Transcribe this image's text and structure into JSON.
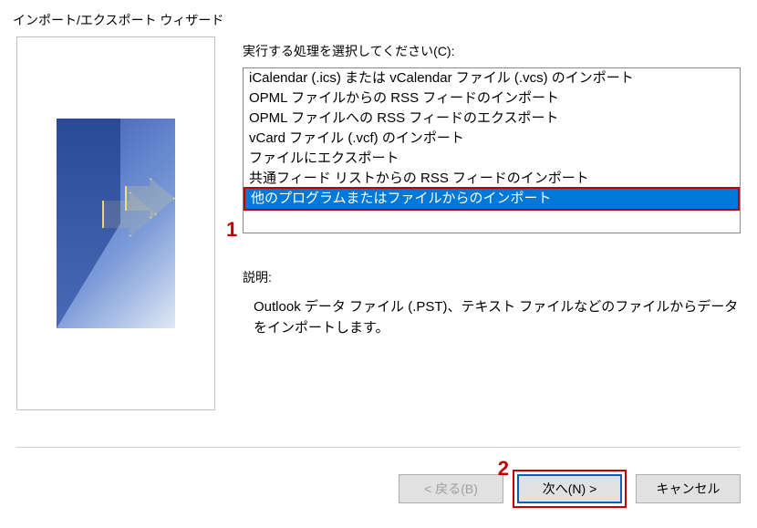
{
  "title": "インポート/エクスポート ウィザード",
  "listLabel": "実行する処理を選択してください(C):",
  "listItems": [
    {
      "label": "iCalendar (.ics) または vCalendar ファイル (.vcs) のインポート",
      "selected": false
    },
    {
      "label": "OPML ファイルからの RSS フィードのインポート",
      "selected": false
    },
    {
      "label": "OPML ファイルへの RSS フィードのエクスポート",
      "selected": false
    },
    {
      "label": "vCard ファイル (.vcf) のインポート",
      "selected": false
    },
    {
      "label": "ファイルにエクスポート",
      "selected": false
    },
    {
      "label": "共通フィード リストからの RSS フィードのインポート",
      "selected": false
    },
    {
      "label": "他のプログラムまたはファイルからのインポート",
      "selected": true
    }
  ],
  "descriptionLabel": "説明:",
  "descriptionText": "Outlook データ ファイル (.PST)、テキスト ファイルなどのファイルからデータをインポートします。",
  "buttons": {
    "back": "< 戻る(B)",
    "next": "次へ(N) >",
    "cancel": "キャンセル"
  },
  "annotations": {
    "one": "1",
    "two": "2"
  }
}
